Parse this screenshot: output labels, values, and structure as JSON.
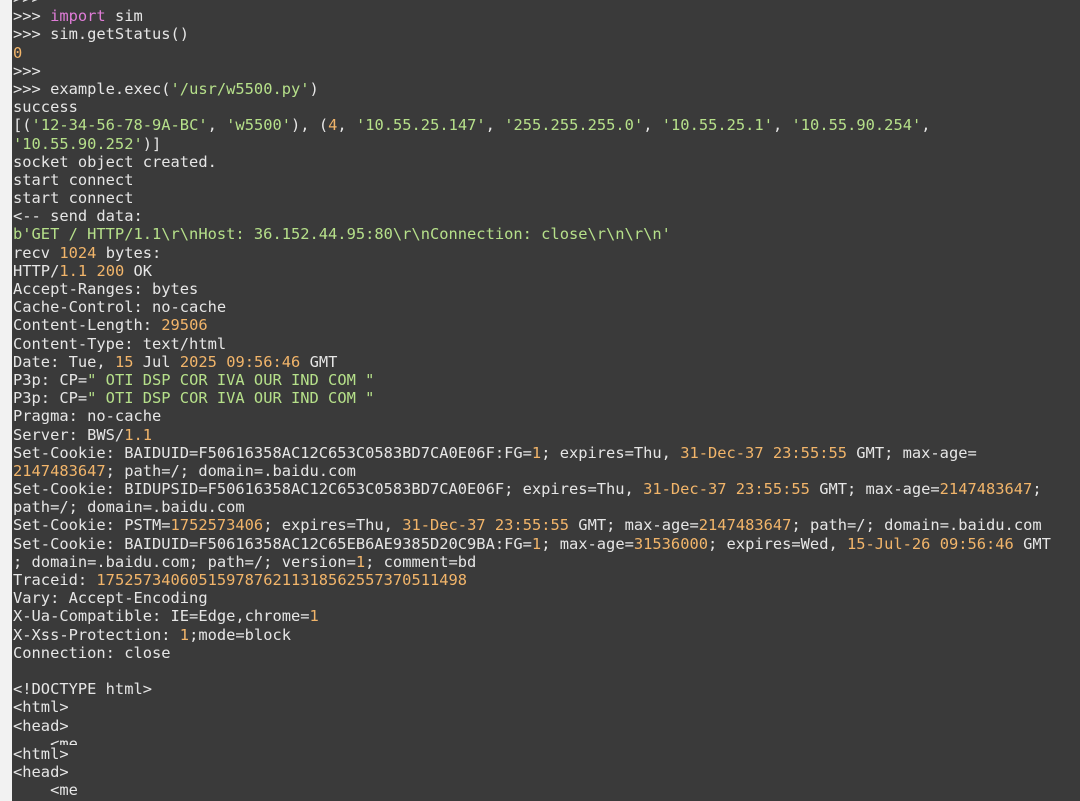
{
  "colors": {
    "background": "#3a3a3a",
    "text": "#e6e6e6",
    "keyword": "#e07cd8",
    "string": "#b6e08a",
    "number": "#f2b56a",
    "gutter": "#f2f2f2"
  },
  "terminal": {
    "lines": [
      [
        [
          "p",
          ">>>"
        ]
      ],
      [
        [
          "p",
          ">>> "
        ],
        [
          "k",
          "import"
        ],
        [
          "p",
          " sim"
        ]
      ],
      [
        [
          "p",
          ">>> sim.getStatus()"
        ]
      ],
      [
        [
          "n",
          "0"
        ]
      ],
      [
        [
          "p",
          ">>>"
        ]
      ],
      [
        [
          "p",
          ">>> example.exec("
        ],
        [
          "s",
          "'/usr/w5500.py'"
        ],
        [
          "p",
          ")"
        ]
      ],
      [
        [
          "p",
          "success"
        ]
      ],
      [
        [
          "p",
          "[("
        ],
        [
          "s",
          "'12-34-56-78-9A-BC'"
        ],
        [
          "p",
          ", "
        ],
        [
          "s",
          "'w5500'"
        ],
        [
          "p",
          "), ("
        ],
        [
          "n",
          "4"
        ],
        [
          "p",
          ", "
        ],
        [
          "s",
          "'10.55.25.147'"
        ],
        [
          "p",
          ", "
        ],
        [
          "s",
          "'255.255.255.0'"
        ],
        [
          "p",
          ", "
        ],
        [
          "s",
          "'10.55.25.1'"
        ],
        [
          "p",
          ", "
        ],
        [
          "s",
          "'10.55.90.254'"
        ],
        [
          "p",
          ","
        ]
      ],
      [
        [
          "s",
          "'10.55.90.252'"
        ],
        [
          "p",
          ")]"
        ]
      ],
      [
        [
          "p",
          "socket object created."
        ]
      ],
      [
        [
          "p",
          "start connect"
        ]
      ],
      [
        [
          "p",
          "start connect"
        ]
      ],
      [
        [
          "p",
          "<-- send data:"
        ]
      ],
      [
        [
          "s",
          "b'GET / HTTP/1.1\\r\\nHost: 36.152.44.95:80\\r\\nConnection: close\\r\\n\\r\\n'"
        ]
      ],
      [
        [
          "p",
          "recv "
        ],
        [
          "n",
          "1024"
        ],
        [
          "p",
          " bytes:"
        ]
      ],
      [
        [
          "p",
          "HTTP/"
        ],
        [
          "n",
          "1.1"
        ],
        [
          "p",
          " "
        ],
        [
          "n",
          "200"
        ],
        [
          "p",
          " OK"
        ]
      ],
      [
        [
          "p",
          "Accept-Ranges: bytes"
        ]
      ],
      [
        [
          "p",
          "Cache-Control: no-cache"
        ]
      ],
      [
        [
          "p",
          "Content-Length: "
        ],
        [
          "n",
          "29506"
        ]
      ],
      [
        [
          "p",
          "Content-Type: text/html"
        ]
      ],
      [
        [
          "p",
          "Date: Tue, "
        ],
        [
          "n",
          "15"
        ],
        [
          "p",
          " Jul "
        ],
        [
          "n",
          "2025"
        ],
        [
          "p",
          " "
        ],
        [
          "n",
          "09:56:46"
        ],
        [
          "p",
          " GMT"
        ]
      ],
      [
        [
          "p",
          "P3p: CP="
        ],
        [
          "s",
          "\" OTI DSP COR IVA OUR IND COM \""
        ]
      ],
      [
        [
          "p",
          "P3p: CP="
        ],
        [
          "s",
          "\" OTI DSP COR IVA OUR IND COM \""
        ]
      ],
      [
        [
          "p",
          "Pragma: no-cache"
        ]
      ],
      [
        [
          "p",
          "Server: BWS/"
        ],
        [
          "n",
          "1.1"
        ]
      ],
      [
        [
          "p",
          "Set-Cookie: BAIDUID=F50616358AC12C653C0583BD7CA0E06F:FG="
        ],
        [
          "n",
          "1"
        ],
        [
          "p",
          "; expires=Thu, "
        ],
        [
          "n",
          "31-Dec-37"
        ],
        [
          "p",
          " "
        ],
        [
          "n",
          "23:55:55"
        ],
        [
          "p",
          " GMT; max-age="
        ]
      ],
      [
        [
          "n",
          "2147483647"
        ],
        [
          "p",
          "; path=/; domain=.baidu.com"
        ]
      ],
      [
        [
          "p",
          "Set-Cookie: BIDUPSID=F50616358AC12C653C0583BD7CA0E06F; expires=Thu, "
        ],
        [
          "n",
          "31-Dec-37"
        ],
        [
          "p",
          " "
        ],
        [
          "n",
          "23:55:55"
        ],
        [
          "p",
          " GMT; max-age="
        ],
        [
          "n",
          "2147483647"
        ],
        [
          "p",
          ";"
        ]
      ],
      [
        [
          "p",
          "path=/; domain=.baidu.com"
        ]
      ],
      [
        [
          "p",
          "Set-Cookie: PSTM="
        ],
        [
          "n",
          "1752573406"
        ],
        [
          "p",
          "; expires=Thu, "
        ],
        [
          "n",
          "31-Dec-37"
        ],
        [
          "p",
          " "
        ],
        [
          "n",
          "23:55:55"
        ],
        [
          "p",
          " GMT; max-age="
        ],
        [
          "n",
          "2147483647"
        ],
        [
          "p",
          "; path=/; domain=.baidu.com"
        ]
      ],
      [
        [
          "p",
          "Set-Cookie: BAIDUID=F50616358AC12C65EB6AE9385D20C9BA:FG="
        ],
        [
          "n",
          "1"
        ],
        [
          "p",
          "; max-age="
        ],
        [
          "n",
          "31536000"
        ],
        [
          "p",
          "; expires=Wed, "
        ],
        [
          "n",
          "15-Jul-26"
        ],
        [
          "p",
          " "
        ],
        [
          "n",
          "09:56:46"
        ],
        [
          "p",
          " GMT"
        ]
      ],
      [
        [
          "p",
          "; domain=.baidu.com; path=/; version="
        ],
        [
          "n",
          "1"
        ],
        [
          "p",
          "; comment=bd"
        ]
      ],
      [
        [
          "p",
          "Traceid: "
        ],
        [
          "n",
          "1752573406051597876211318562557370511498"
        ]
      ],
      [
        [
          "p",
          "Vary: Accept-Encoding"
        ]
      ],
      [
        [
          "p",
          "X-Ua-Compatible: IE=Edge,chrome="
        ],
        [
          "n",
          "1"
        ]
      ],
      [
        [
          "p",
          "X-Xss-Protection: "
        ],
        [
          "n",
          "1"
        ],
        [
          "p",
          ";mode=block"
        ]
      ],
      [
        [
          "p",
          "Connection: close"
        ]
      ],
      [
        [
          "p",
          ""
        ]
      ],
      [
        [
          "p",
          "<!DOCTYPE html>"
        ]
      ],
      [
        [
          "p",
          "<html>"
        ]
      ],
      [
        [
          "p",
          "<head>"
        ]
      ],
      [
        [
          "p",
          "    <me"
        ]
      ],
      [
        [
          "p",
          "<html>"
        ]
      ],
      [
        [
          "p",
          "<head>"
        ]
      ],
      [
        [
          "p",
          "    <me"
        ]
      ]
    ]
  }
}
